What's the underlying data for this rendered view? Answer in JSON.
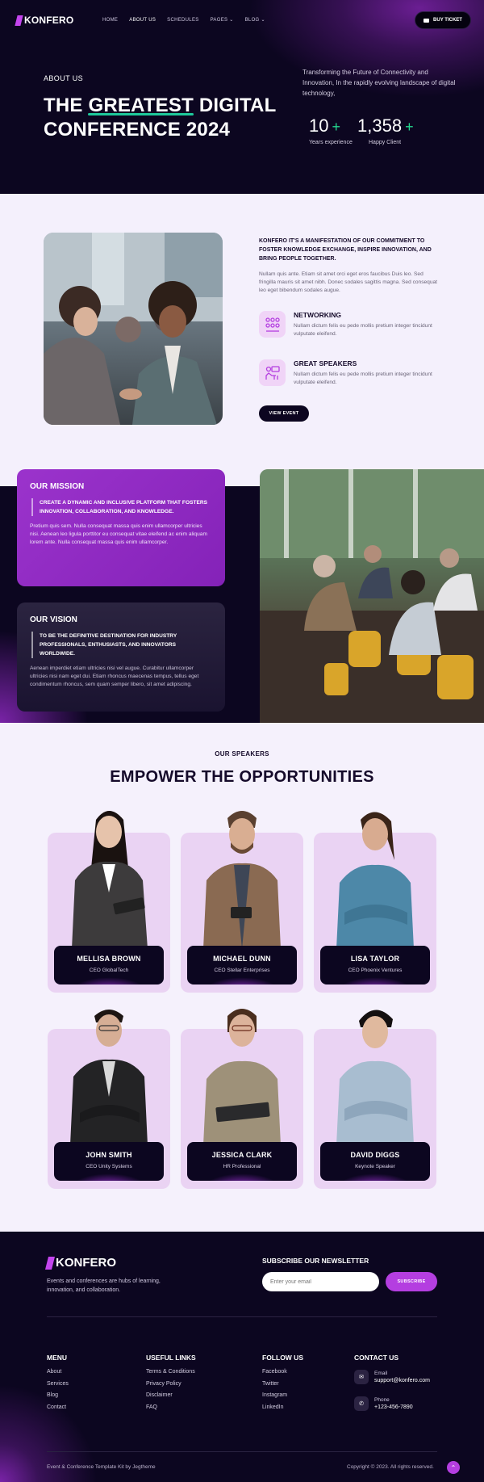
{
  "brand": {
    "name": "KONFERO"
  },
  "nav": {
    "items": [
      {
        "label": "HOME"
      },
      {
        "label": "ABOUT US"
      },
      {
        "label": "SCHEDULES"
      },
      {
        "label": "PAGES"
      },
      {
        "label": "BLOG"
      }
    ],
    "ticket": "BUY TICKET"
  },
  "hero": {
    "kicker": "ABOUT US",
    "title_pre": "THE ",
    "title_hl": "GREATEST",
    "title_post": " DIGITAL",
    "title_line2": "CONFERENCE 2024",
    "desc": "Transforming the Future of Connectivity and Innovation, In the rapidly evolving landscape of digital technology,",
    "stats": [
      {
        "num": "10",
        "plus": "+",
        "label": "Years experience"
      },
      {
        "num": "1,358",
        "plus": "+",
        "label": "Happy Client"
      }
    ]
  },
  "about": {
    "heading": "KONFERO IT'S A MANIFESTATION OF OUR COMMITMENT TO FOSTER KNOWLEDGE EXCHANGE, INSPIRE INNOVATION, AND BRING PEOPLE TOGETHER.",
    "body": "Nullam quis ante. Etiam sit amet orci eget eros faucibus Duis leo. Sed fringilla mauris sit amet nibh. Donec sodales sagittis magna. Sed consequat leo eget bibendum sodales augue.",
    "features": [
      {
        "title": "NETWORKING",
        "desc": "Nullam dictum felis eu pede mollis pretium integer tincidunt vulputate eleifend."
      },
      {
        "title": "GREAT SPEAKERS",
        "desc": "Nullam dictum felis eu pede mollis pretium integer tincidunt vulputate eleifend."
      }
    ],
    "button": "VIEW EVENT"
  },
  "mission": {
    "title": "OUR MISSION",
    "quote": "CREATE A DYNAMIC AND INCLUSIVE PLATFORM THAT FOSTERS INNOVATION, COLLABORATION, AND KNOWLEDGE.",
    "body": "Pretium quis sem. Nulla consequat massa quis enim ullamcorper ultricies nisi. Aenean leo ligula porttitor eu consequat vitae eleifend ac enim aliquam lorem ante. Nulla consequat massa quis enim ullamcorper."
  },
  "vision": {
    "title": "OUR VISION",
    "quote": "TO BE THE DEFINITIVE DESTINATION FOR INDUSTRY PROFESSIONALS, ENTHUSIASTS, AND INNOVATORS WORLDWIDE.",
    "body": "Aenean imperdiet etiam ultricies nisi vel augue. Curabitur ullamcorper ultricies nisi nam eget dui. Etiam rhoncus maecenas tempus, tellus eget condimentum rhoncus, sem quam semper libero, sit amet adipiscing."
  },
  "speakers": {
    "kicker": "OUR SPEAKERS",
    "title": "EMPOWER THE OPPORTUNITIES",
    "list": [
      {
        "name": "MELLISA BROWN",
        "role": "CEO GlobalTech"
      },
      {
        "name": "MICHAEL DUNN",
        "role": "CEO Stellar Enterprises"
      },
      {
        "name": "LISA TAYLOR",
        "role": "CEO Phoenix Ventures"
      },
      {
        "name": "JOHN SMITH",
        "role": "CEO Unity Systems"
      },
      {
        "name": "JESSICA CLARK",
        "role": "HR Professional"
      },
      {
        "name": "DAVID DIGGS",
        "role": "Keynote Speaker"
      }
    ]
  },
  "footer": {
    "desc": "Events and conferences are hubs of learning, innovation, and collaboration.",
    "newsletter_title": "SUBSCRIBE OUR NEWSLETTER",
    "email_placeholder": "Enter your email",
    "subscribe": "SUBSCRIBE",
    "menu": {
      "title": "MENU",
      "items": [
        "About",
        "Services",
        "Blog",
        "Contact"
      ]
    },
    "links": {
      "title": "USEFUL LINKS",
      "items": [
        "Terms & Conditions",
        "Privacy Policy",
        "Disclaimer",
        "FAQ"
      ]
    },
    "follow": {
      "title": "FOLLOW US",
      "items": [
        "Facebook",
        "Twitter",
        "Instagram",
        "LinkedIn"
      ]
    },
    "contact": {
      "title": "CONTACT US",
      "email_label": "Email",
      "email": "support@konfero.com",
      "phone_label": "Phone",
      "phone": "+123-456-7890"
    },
    "credit": "Event & Conference Template Kit by Jegtheme",
    "copyright": "Copyright © 2023. All rights reserved."
  },
  "colors": {
    "accent": "#b43ee0",
    "dark": "#0c0620",
    "green": "#24d88f",
    "light": "#f4f0fc"
  }
}
